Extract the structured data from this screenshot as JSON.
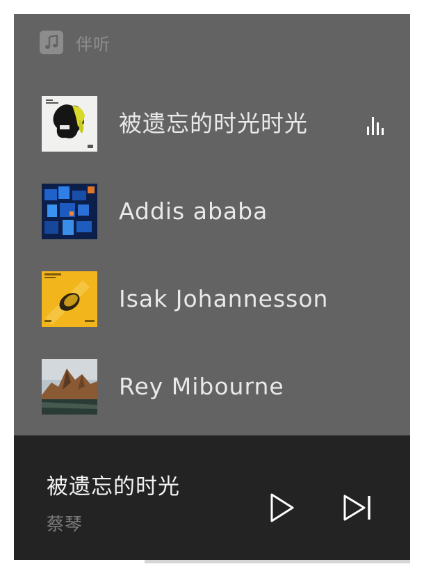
{
  "app": {
    "name": "伴听",
    "icon": "music-note-icon"
  },
  "playlist": [
    {
      "title": "被遗忘的时光时光",
      "playing": true,
      "art": "black-yellow-abstract-cover"
    },
    {
      "title": "Addis ababa",
      "playing": false,
      "art": "blue-cubes-cover"
    },
    {
      "title": "Isak Johannesson",
      "playing": false,
      "art": "yellow-disc-cover"
    },
    {
      "title": "Rey Mibourne",
      "playing": false,
      "art": "mountain-landscape-cover"
    }
  ],
  "now_playing": {
    "title": "被遗忘的时光",
    "artist": "蔡琴"
  },
  "controls": {
    "play_icon": "play-icon",
    "next_icon": "skip-next-icon"
  },
  "progress": {
    "fraction": 0.33
  },
  "colors": {
    "panel": "#636363",
    "player": "#232323",
    "text": "#e9e9e9"
  }
}
